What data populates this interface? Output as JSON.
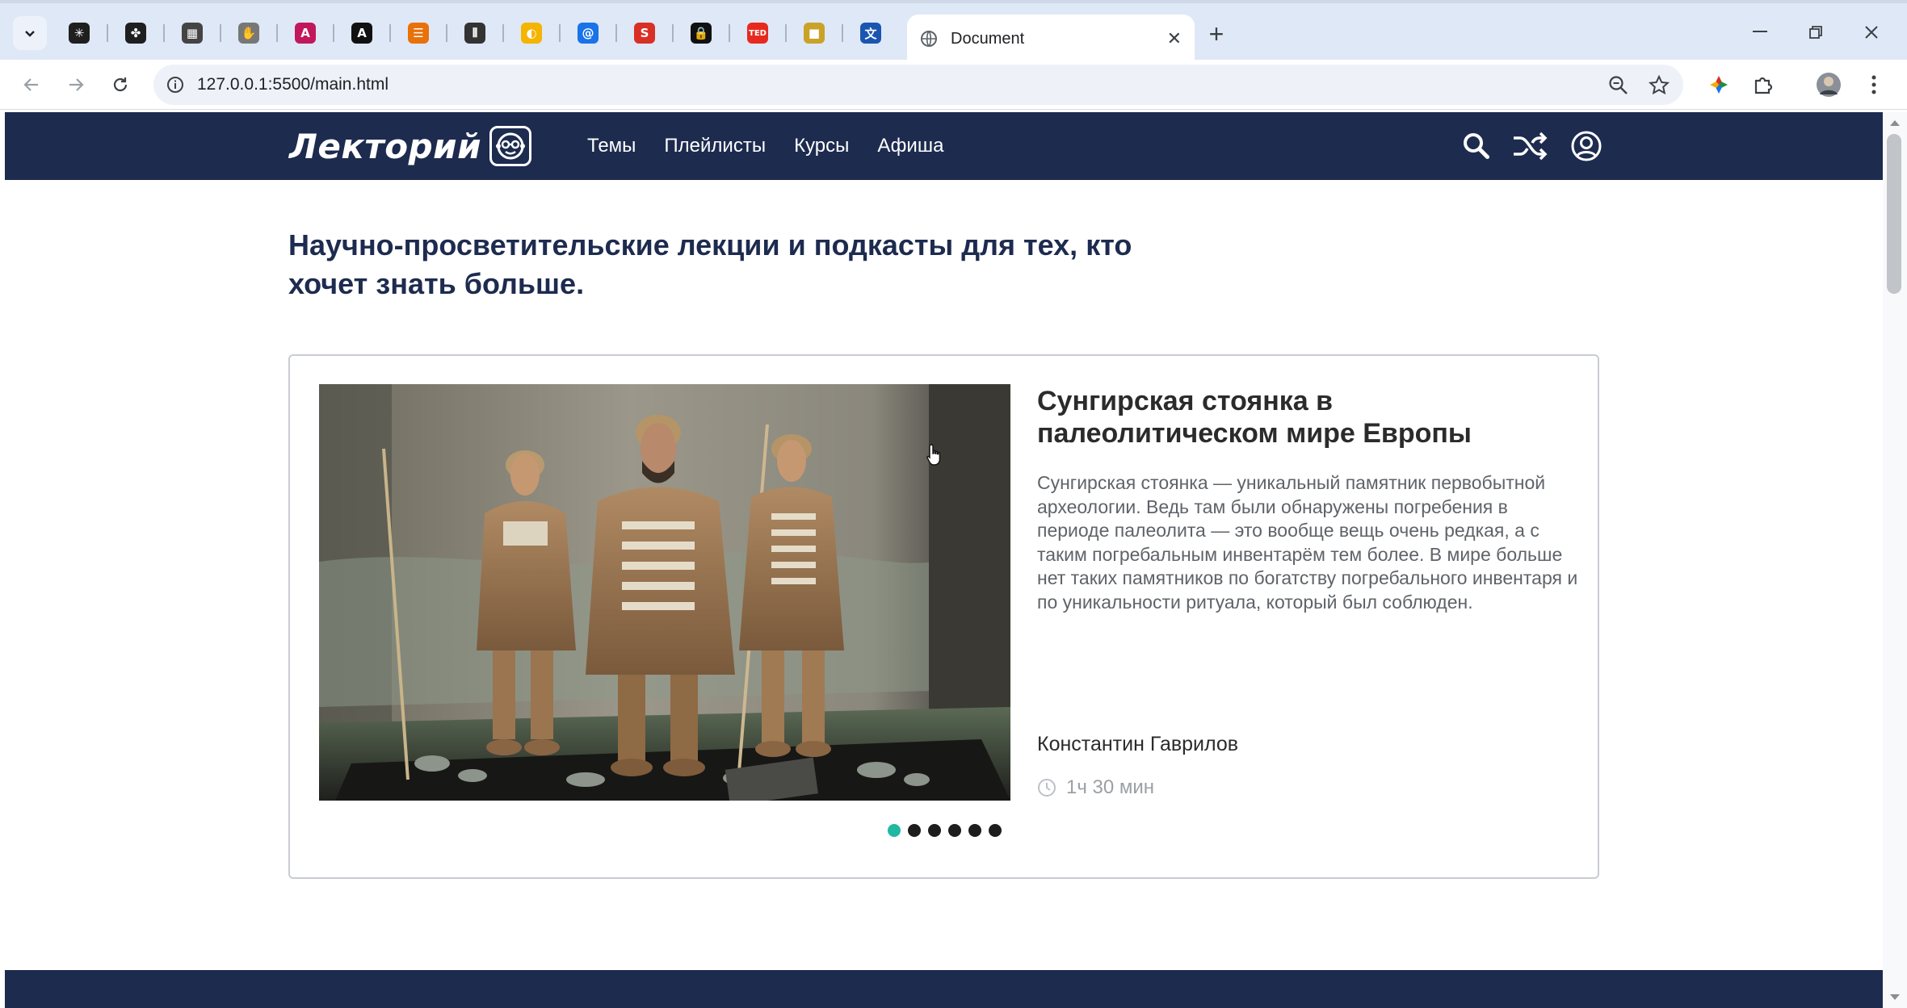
{
  "browser": {
    "active_tab_title": "Document",
    "url": "127.0.0.1:5500/main.html",
    "pinned_tabs": [
      {
        "icon": "perplexity-icon",
        "glyph": "✳",
        "color": "#1f1f1f"
      },
      {
        "icon": "figma-like-icon",
        "glyph": "✤",
        "color": "#1f1f1f"
      },
      {
        "icon": "qr-pattern-icon",
        "glyph": "▦",
        "color": "#444444"
      },
      {
        "icon": "hand-icon",
        "glyph": "✋",
        "color": "#777777"
      },
      {
        "icon": "pink-app-icon",
        "glyph": "A",
        "color": "#c2185b"
      },
      {
        "icon": "letter-a-icon",
        "glyph": "A",
        "color": "#111111"
      },
      {
        "icon": "stacked-bars-icon",
        "glyph": "☰",
        "color": "#e8710a"
      },
      {
        "icon": "waveform-icon",
        "glyph": "⦀",
        "color": "#333333"
      },
      {
        "icon": "circle-logo-icon",
        "glyph": "◐",
        "color": "#f4b400"
      },
      {
        "icon": "at-sign-icon",
        "glyph": "@",
        "color": "#1a73e8"
      },
      {
        "icon": "letter-s-icon",
        "glyph": "S",
        "color": "#d93025"
      },
      {
        "icon": "lock-icon",
        "glyph": "🔒",
        "color": "#111111"
      },
      {
        "icon": "ted-icon",
        "glyph": "TED",
        "color": "#e62b1e"
      },
      {
        "icon": "bag-icon",
        "glyph": "■",
        "color": "#c9a227"
      },
      {
        "icon": "translate-icon",
        "glyph": "文",
        "color": "#1a56b0"
      }
    ]
  },
  "site": {
    "logo_text": "Лекторий",
    "nav": [
      "Темы",
      "Плейлисты",
      "Курсы",
      "Афиша"
    ],
    "headline": "Научно-просветительские лекции и подкасты для тех, кто хочет знать больше."
  },
  "featured": {
    "title": "Сунгирская стоянка в палеолитическом мире Европы",
    "description": "Сунгирская стоянка — уникальный памятник первобытной археологии. Ведь там были обнаружены погребения в периоде палеолита — это вообще вещь очень редкая, а с таким погребальным инвентарём тем более. В мире больше нет таких памятников по богатству погребального инвентаря и по уникальности ритуала, который был соблюден.",
    "author": "Константин Гаврилов",
    "duration": "1ч 30 мин",
    "slides_total": 6,
    "active_slide": 1
  },
  "colors": {
    "header_bg": "#1d2b4f",
    "accent_dot": "#21b8a3",
    "headline": "#1d2b4f"
  }
}
